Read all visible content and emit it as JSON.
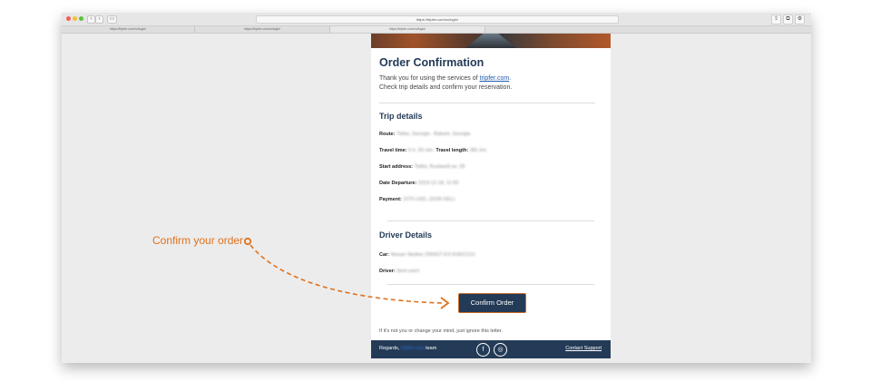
{
  "browser": {
    "url": "https://tripfer.com/ru/login/",
    "tabs": [
      "https://tripfer.com/ru/login/",
      "https://tripfer.com/ru/login/",
      "https://tripfer.com/ru/login/"
    ],
    "nav_icons": [
      "back-icon",
      "forward-icon",
      "sidebar-icon"
    ],
    "right_icons": [
      "share-icon",
      "tabs-icon",
      "settings-icon"
    ]
  },
  "email": {
    "title": "Order Confirmation",
    "intro_line1_prefix": "Thank you for using the services of ",
    "intro_link": "tripfer.com",
    "intro_line1_suffix": ".",
    "intro_line2": "Check trip details and confirm your reservation.",
    "trip_heading": "Trip details",
    "route_label": "Route:",
    "route_value": "Tbilisi, Georgia - Batumi, Georgia",
    "travel_time_label": "Travel time:",
    "travel_time_value": "5 h. 55 min.",
    "travel_length_label": "Travel length:",
    "travel_length_value": "381 km.",
    "start_address_label": "Start address:",
    "start_address_value": "Tbilisi, Rustaveli av. 28",
    "date_label": "Date  Departure:",
    "date_value": "2019-12-18, 11:00",
    "payment_label": "Payment:",
    "payment_value": "1075 USD, (3199 GEL)",
    "driver_heading": "Driver Details",
    "car_label": "Car:",
    "car_value": "Nissan Skyline 2000GT-ES KHGC210",
    "driver_label": "Driver:",
    "driver_value": "(test-user)",
    "confirm_button": "Confirm Order",
    "ignore_text": "If it's not you or change your mind, just ignore this letter.",
    "footer_regards": "Regards,",
    "footer_link": "tripfer.com",
    "footer_team": "team",
    "facebook_glyph": "f",
    "instagram_glyph": "◎",
    "contact_support": "Contact Support"
  },
  "annotation": {
    "callout": "Confirm your order",
    "color": "#e0711c"
  },
  "colors": {
    "navy": "#243b57",
    "orange": "#e0711c",
    "link": "#1d59b0"
  }
}
